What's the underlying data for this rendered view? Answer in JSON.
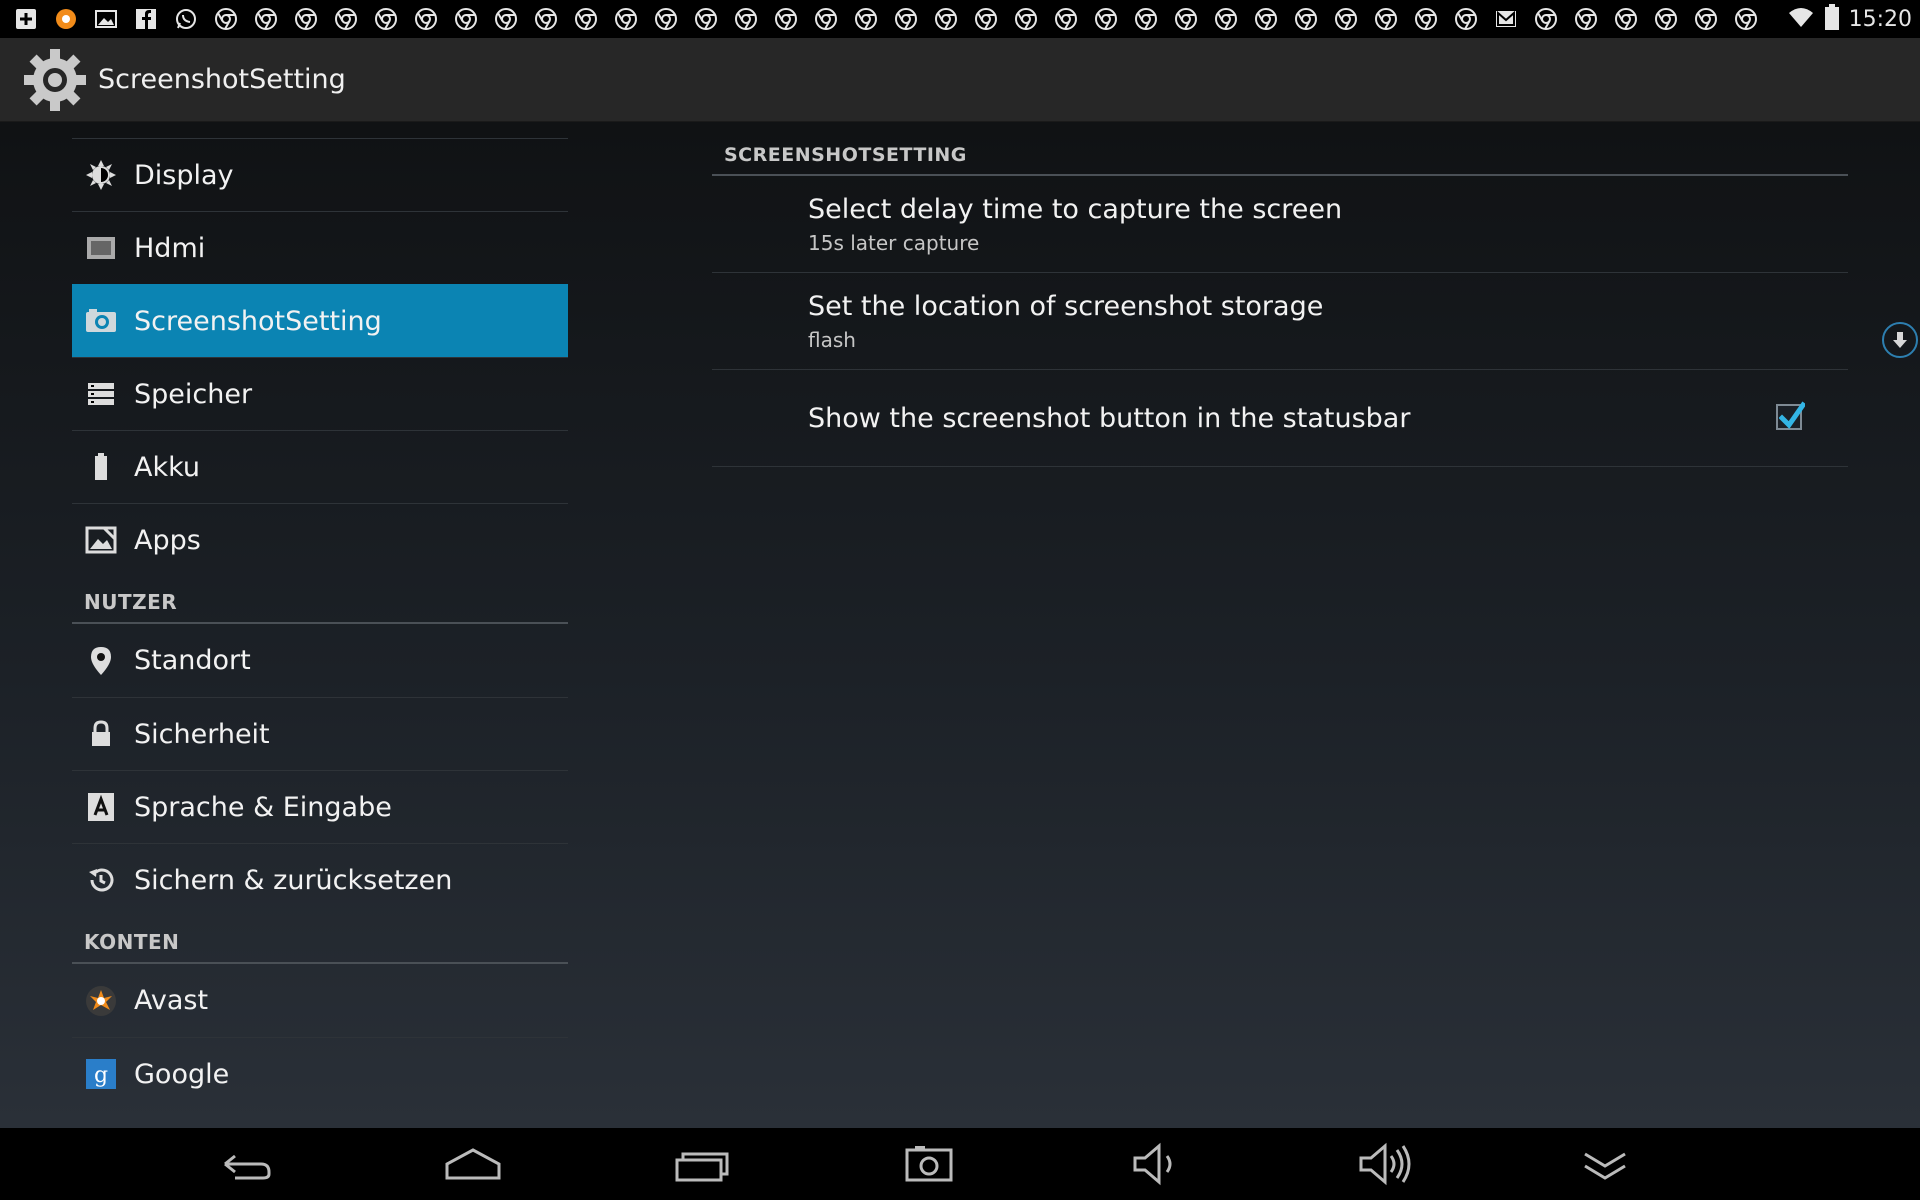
{
  "statusbar": {
    "time": "15:20",
    "notification_icons": [
      "add-box-icon",
      "avast-icon",
      "image-icon",
      "facebook-icon",
      "whatsapp-icon",
      "chrome-icon",
      "chrome-icon",
      "chrome-icon",
      "chrome-icon",
      "chrome-icon",
      "chrome-icon",
      "chrome-icon",
      "chrome-icon",
      "chrome-icon",
      "chrome-icon",
      "chrome-icon",
      "chrome-icon",
      "chrome-icon",
      "chrome-icon",
      "chrome-icon",
      "chrome-icon",
      "chrome-icon",
      "chrome-icon",
      "chrome-icon",
      "chrome-icon",
      "chrome-icon",
      "chrome-icon",
      "chrome-icon",
      "chrome-icon",
      "chrome-icon",
      "chrome-icon",
      "chrome-icon",
      "chrome-icon",
      "chrome-icon",
      "chrome-icon",
      "chrome-icon",
      "chrome-icon",
      "gmail-icon",
      "chrome-icon",
      "chrome-icon",
      "chrome-icon",
      "chrome-icon",
      "chrome-icon",
      "chrome-icon"
    ]
  },
  "actionbar": {
    "title": "ScreenshotSetting"
  },
  "sidebar": {
    "items_top": [
      {
        "label": "Display",
        "icon": "brightness-icon"
      },
      {
        "label": "Hdmi",
        "icon": "hdmi-icon"
      },
      {
        "label": "ScreenshotSetting",
        "icon": "camera-icon",
        "active": true
      },
      {
        "label": "Speicher",
        "icon": "storage-icon"
      },
      {
        "label": "Akku",
        "icon": "battery-icon"
      },
      {
        "label": "Apps",
        "icon": "apps-icon"
      }
    ],
    "section_users": "NUTZER",
    "items_users": [
      {
        "label": "Standort",
        "icon": "location-icon"
      },
      {
        "label": "Sicherheit",
        "icon": "lock-icon"
      },
      {
        "label": "Sprache & Eingabe",
        "icon": "language-icon"
      },
      {
        "label": "Sichern & zurücksetzen",
        "icon": "backup-icon"
      }
    ],
    "section_accounts": "KONTEN",
    "items_accounts": [
      {
        "label": "Avast",
        "icon": "avast-icon"
      },
      {
        "label": "Google",
        "icon": "google-icon"
      }
    ]
  },
  "main": {
    "header": "SCREENSHOTSETTING",
    "prefs": [
      {
        "title": "Select delay time to capture the screen",
        "summary": "15s later capture"
      },
      {
        "title": "Set the location of screenshot storage",
        "summary": "flash"
      },
      {
        "title": "Show the screenshot button in the statusbar",
        "checked": true
      }
    ]
  },
  "navbar": {
    "buttons": [
      "back-icon",
      "home-icon",
      "recents-icon",
      "screenshot-icon",
      "volume-down-icon",
      "volume-up-icon",
      "collapse-icon"
    ]
  },
  "colors": {
    "accent": "#0b84b3",
    "checkmark": "#33b5e5"
  }
}
